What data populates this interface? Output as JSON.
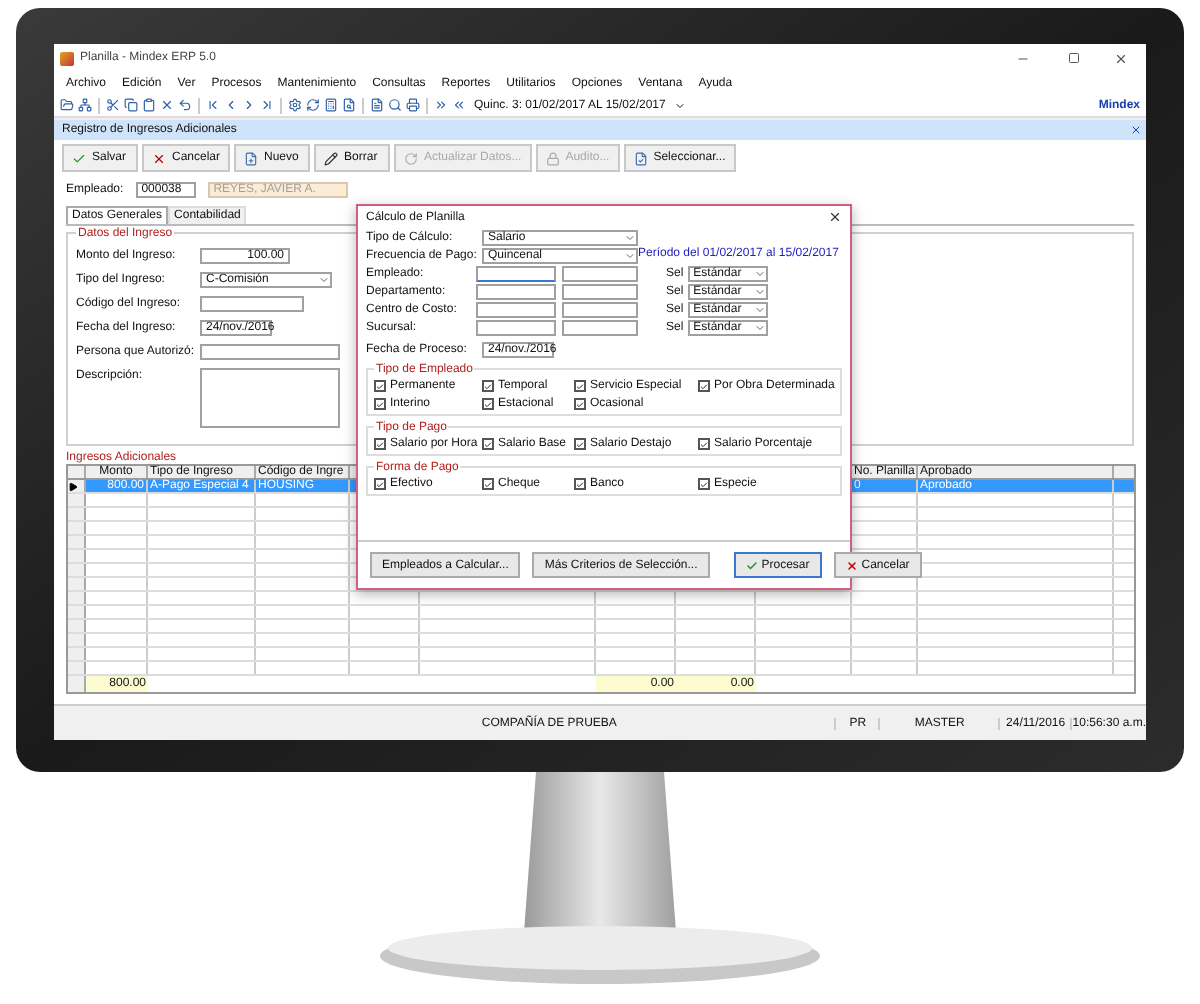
{
  "window": {
    "title": "Planilla - Mindex ERP 5.0"
  },
  "menu": [
    "Archivo",
    "Edición",
    "Ver",
    "Procesos",
    "Mantenimiento",
    "Consultas",
    "Reportes",
    "Utilitarios",
    "Opciones",
    "Ventana",
    "Ayuda"
  ],
  "toolbar": {
    "period": "Quinc. 3: 01/02/2017 AL 15/02/2017",
    "brand": "Mindex"
  },
  "document_tab": {
    "title": "Registro de Ingresos Adicionales"
  },
  "actions": [
    {
      "label": "Salvar",
      "kind": "save",
      "disabled": false
    },
    {
      "label": "Cancelar",
      "kind": "cancel",
      "disabled": false
    },
    {
      "label": "Nuevo",
      "kind": "new",
      "disabled": false
    },
    {
      "label": "Borrar",
      "kind": "delete",
      "disabled": false
    },
    {
      "label": "Actualizar Datos...",
      "kind": "refresh",
      "disabled": true
    },
    {
      "label": "Audito...",
      "kind": "audit",
      "disabled": true
    },
    {
      "label": "Seleccionar...",
      "kind": "select",
      "disabled": false
    }
  ],
  "employee": {
    "label": "Empleado:",
    "code": "000038",
    "name": "REYES, JAVIER A."
  },
  "form_tabs": [
    {
      "label": "Datos Generales",
      "selected": true
    },
    {
      "label": "Contabilidad",
      "selected": false
    }
  ],
  "income_group": {
    "title": "Datos del Ingreso",
    "fields": [
      {
        "label": "Monto del Ingreso:",
        "kind": "number",
        "value": "100.00"
      },
      {
        "label": "Tipo del Ingreso:",
        "kind": "combo",
        "value": "C-Comisión"
      },
      {
        "label": "Código del Ingreso:",
        "kind": "text"
      },
      {
        "label": "Fecha del Ingreso:",
        "kind": "date",
        "value": "24/nov./2016"
      },
      {
        "label": "Persona que Autorizó:",
        "kind": "wide"
      },
      {
        "label": "Descripción:",
        "kind": "tall"
      }
    ]
  },
  "grid": {
    "title": "Ingresos Adicionales",
    "columns": [
      "Monto",
      "Tipo de Ingreso",
      "Código de Ingre",
      "No. Planilla",
      "Aprobado"
    ],
    "rows": [
      {
        "selected": true,
        "cells": [
          "800.00",
          "A-Pago Especial 4",
          "HOUSING",
          "0",
          "Aprobado"
        ]
      }
    ],
    "totals": [
      "800.00",
      "0.00",
      "0.00"
    ]
  },
  "dialog": {
    "title": "Cálculo de Planilla",
    "calc_type": {
      "label": "Tipo de Cálculo:",
      "value": "Salario"
    },
    "pay_frequency": {
      "label": "Frecuencia de Pago:",
      "value": "Quincenal"
    },
    "period": "Período del 01/02/2017 al 15/02/2017",
    "filters": [
      {
        "label": "Empleado:",
        "sel": "Sel",
        "mode": "Estándar"
      },
      {
        "label": "Departamento:",
        "sel": "Sel",
        "mode": "Estándar"
      },
      {
        "label": "Centro de Costo:",
        "sel": "Sel",
        "mode": "Estándar"
      },
      {
        "label": "Sucursal:",
        "sel": "Sel",
        "mode": "Estándar"
      }
    ],
    "process_date": {
      "label": "Fecha de Proceso:",
      "value": "24/nov./2016"
    },
    "groups": [
      {
        "title": "Tipo de Empleado",
        "options": [
          {
            "label": "Permanente",
            "checked": true
          },
          {
            "label": "Temporal",
            "checked": true
          },
          {
            "label": "Servicio Especial",
            "checked": true
          },
          {
            "label": "Por Obra Determinada",
            "checked": true
          },
          {
            "label": "Interino",
            "checked": true
          },
          {
            "label": "Estacional",
            "checked": true
          },
          {
            "label": "Ocasional",
            "checked": true
          }
        ]
      },
      {
        "title": "Tipo de Pago",
        "options": [
          {
            "label": "Salario por Hora",
            "checked": true
          },
          {
            "label": "Salario Base",
            "checked": true
          },
          {
            "label": "Salario Destajo",
            "checked": true
          },
          {
            "label": "Salario Porcentaje",
            "checked": true
          }
        ]
      },
      {
        "title": "Forma de Pago",
        "options": [
          {
            "label": "Efectivo",
            "checked": true
          },
          {
            "label": "Cheque",
            "checked": true
          },
          {
            "label": "Banco",
            "checked": true
          },
          {
            "label": "Especie",
            "checked": true
          }
        ]
      }
    ],
    "buttons": [
      {
        "label": "Empleados a Calcular...",
        "kind": "plain"
      },
      {
        "label": "Más Criterios de Selección...",
        "kind": "plain"
      },
      {
        "label": "Procesar",
        "kind": "ok"
      },
      {
        "label": "Cancelar",
        "kind": "cancel"
      }
    ]
  },
  "status_bar": {
    "company": "COMPAÑÍA DE PRUEBA",
    "code": "PR",
    "user": "MASTER",
    "date": "24/11/2016",
    "time": "10:56:30 a.m."
  }
}
